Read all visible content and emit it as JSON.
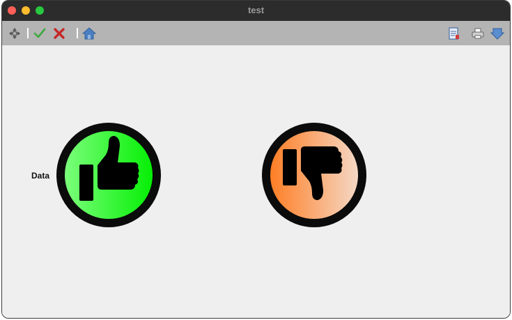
{
  "window": {
    "title": "test"
  },
  "toolbar": {
    "icons": [
      "move-icon",
      "check-icon",
      "close-icon",
      "home-icon",
      "document-icon",
      "print-icon",
      "download-icon"
    ]
  },
  "content": {
    "label": "Data",
    "thumbs_up": {
      "icon": "thumbs-up-icon",
      "color_start": "#80ff80",
      "color_end": "#00ee00"
    },
    "thumbs_down": {
      "icon": "thumbs-down-icon",
      "color_start": "#ff7a1e",
      "color_end": "#f4dccc"
    }
  }
}
